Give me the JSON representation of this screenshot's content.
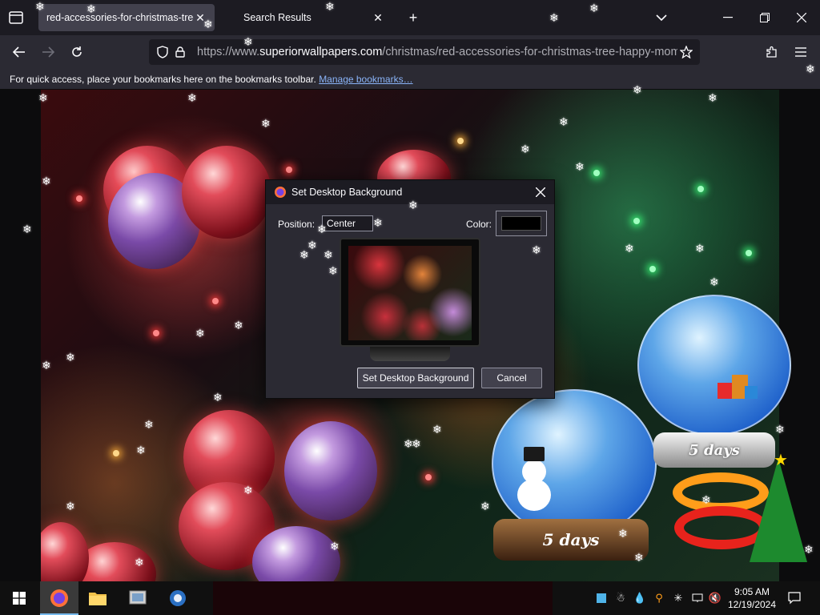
{
  "browser": {
    "tabs": [
      {
        "title": "red-accessories-for-christmas-tree-",
        "active": true
      },
      {
        "title": "Search Results",
        "active": false
      }
    ],
    "new_tab_symbol": "+",
    "url": {
      "prefix": "https://www.",
      "domain": "superiorwallpapers.com",
      "rest": "/christmas/red-accessories-for-christmas-tree-happy-mome"
    },
    "bookmarks_bar": {
      "message": "For quick access, place your bookmarks here on the bookmarks toolbar. ",
      "link": "Manage bookmarks…"
    },
    "icons": {
      "back": "back-arrow-icon",
      "forward": "forward-arrow-icon",
      "reload": "reload-icon",
      "shield": "tracking-protection-icon",
      "lock": "lock-icon",
      "star": "bookmark-star-icon",
      "extensions": "extensions-icon",
      "menu": "hamburger-menu-icon"
    }
  },
  "dialog": {
    "title": "Set Desktop Background",
    "position_label": "Position:",
    "position_value": "Center",
    "color_label": "Color:",
    "color_value": "#000000",
    "set_button": "Set Desktop Background",
    "cancel_button": "Cancel"
  },
  "overlay": {
    "globe_left_label": "5 days",
    "globe_right_label": "5 days"
  },
  "taskbar": {
    "time": "9:05 AM",
    "date": "12/19/2024",
    "apps": [
      "firefox",
      "file-explorer",
      "photos",
      "app"
    ]
  },
  "colors": {
    "toolbar": "#2b2a33",
    "tabbar": "#1c1b22",
    "accent_link": "#8ab4f8",
    "taskbar": "#101010"
  }
}
